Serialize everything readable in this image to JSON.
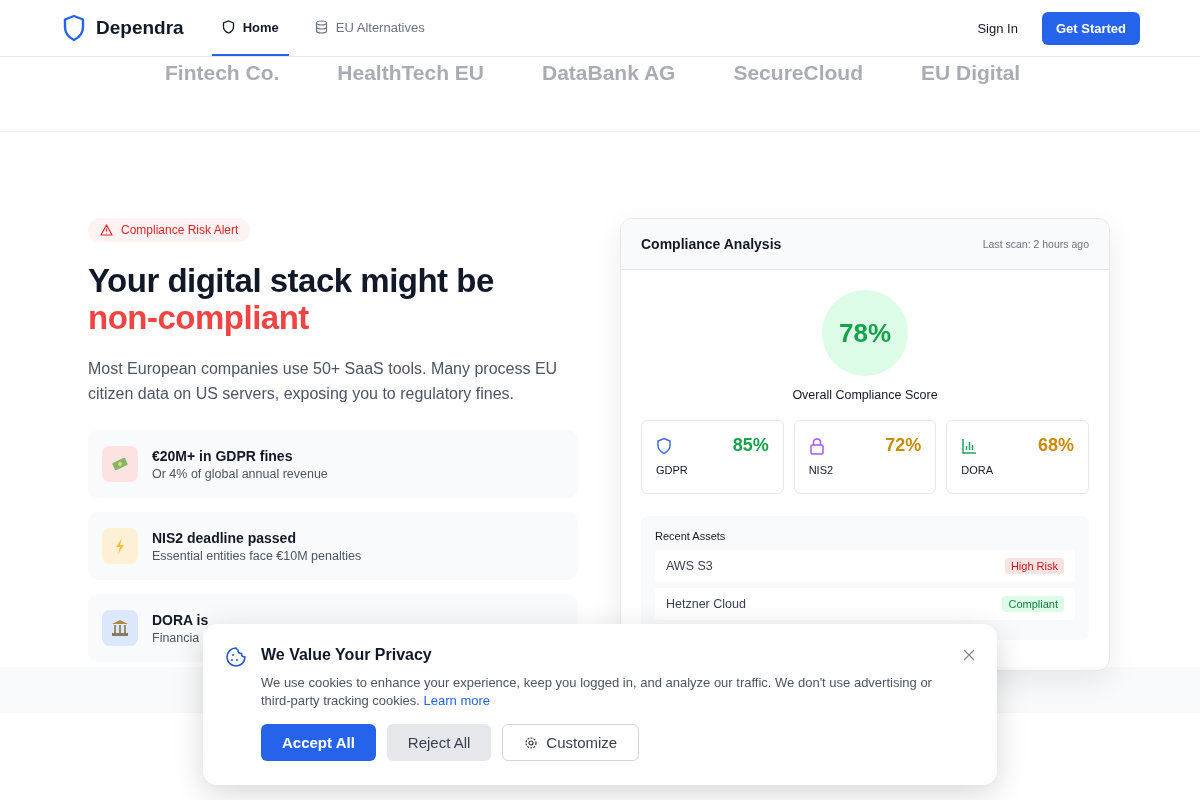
{
  "header": {
    "brand": "Dependra",
    "nav": [
      {
        "label": "Home",
        "selected": true
      },
      {
        "label": "EU Alternatives",
        "selected": false
      }
    ],
    "sign_in": "Sign In",
    "get_started": "Get Started"
  },
  "logos": [
    "Fintech Co.",
    "HealthTech EU",
    "DataBank AG",
    "SecureCloud",
    "EU Digital"
  ],
  "hero": {
    "alert": "Compliance Risk Alert",
    "title": "Your digital stack might be",
    "title_highlight": "non-compliant",
    "description": "Most European companies use 50+ SaaS tools. Many process EU citizen data on US servers, exposing you to regulatory fines.",
    "features": [
      {
        "kind": "danger",
        "title": "€20M+ in GDPR fines",
        "subtitle": "Or 4% of global annual revenue"
      },
      {
        "kind": "warning",
        "title": "NIS2 deadline passed",
        "subtitle": "Essential entities face €10M penalties"
      },
      {
        "kind": "info",
        "title": "DORA is",
        "subtitle": "Financia"
      }
    ]
  },
  "analysis": {
    "title": "Compliance Analysis",
    "last_scan": "Last scan: 2 hours ago",
    "score": "78%",
    "score_label": "Overall Compliance Score",
    "metrics": [
      {
        "value": "85%",
        "label": "GDPR",
        "kind": "good"
      },
      {
        "value": "72%",
        "label": "NIS2",
        "kind": "warning"
      },
      {
        "value": "68%",
        "label": "DORA",
        "kind": "warning"
      }
    ],
    "assets_title": "Recent Assets",
    "assets": [
      {
        "name": "AWS S3",
        "status": "High Risk",
        "kind": "risk"
      },
      {
        "name": "Hetzner Cloud",
        "status": "Compliant",
        "kind": "ok"
      }
    ]
  },
  "cookie": {
    "title": "We Value Your Privacy",
    "text": "We use cookies to enhance your experience, keep you logged in, and analyze our traffic. We don't use advertising or third-party tracking cookies.",
    "link": "Learn more",
    "accept": "Accept All",
    "reject": "Reject All",
    "customize": "Customize"
  }
}
